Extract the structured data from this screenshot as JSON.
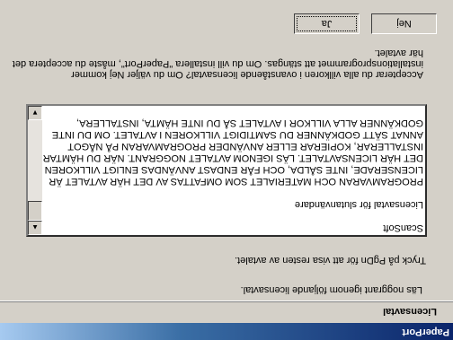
{
  "window": {
    "title": "PaperPort"
  },
  "header": {
    "title": "Licensavtal",
    "subtitle": "Läs noggrant igenom följande licensavtal."
  },
  "hint": "Tryck på PgDn för att visa resten av avtalet.",
  "license": {
    "lines": [
      "ScanSoft",
      "",
      "Licensavtal för slutanvändare",
      "",
      "PROGRAMVARAN OCH MATERIALET SOM OMFATTAS AV DET HÄR AVTALET ÄR",
      "LICENSERADE, INTE SÅLDA, OCH FÅR ENDAST ANVÄNDAS ENLIGT VILLKOREN I",
      "DET HÄR LICENSAVTALET. LÄS IGENOM AVTALET NOGGRANT. NÄR DU HÄMTAR,",
      "INSTALLERAR, KOPIERAR ELLER ANVÄNDER PROGRAMVARAN PÅ NÅGOT",
      "ANNAT SÄTT GODKÄNNER DU SAMTIDIGT VILLKOREN I AVTALET.  OM DU INTE",
      "GODKÄNNER ALLA VILLKOR I AVTALET SÅ DU INTE HÄMTA, INSTALLERA,"
    ]
  },
  "question": {
    "line1": "Accepterar du alla villkoren i ovanstående licensavtal? Om du väljer Nej kommer",
    "line2": "installationsprogrammet att stängas. Om du vill installera \"PaperPort\", måste du acceptera det",
    "line3": "här avtalet."
  },
  "buttons": {
    "yes": "Ja",
    "no": "Nej"
  }
}
